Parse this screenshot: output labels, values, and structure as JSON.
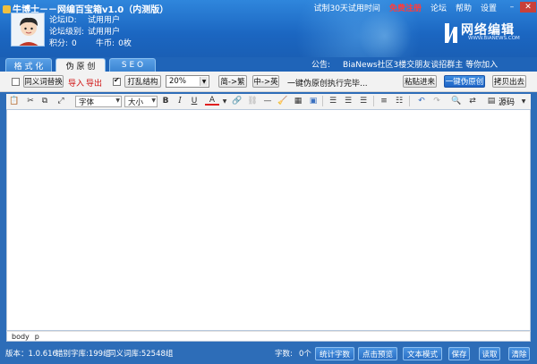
{
  "window": {
    "title": "牛博士－－网编百宝箱v1.0（内测版）",
    "topnav": {
      "trial": "试制30天试用时间",
      "register": "免费注册",
      "forum": "论坛",
      "help": "帮助",
      "settings": "设置"
    }
  },
  "user": {
    "id_label": "论坛ID:",
    "id_value": "试用用户",
    "level_label": "论坛级别:",
    "level_value": "试用用户",
    "points_label": "积分:",
    "points_value": "0",
    "coins_label": "牛币:",
    "coins_value": "0枚"
  },
  "logo": {
    "text": "网络编辑",
    "sub": "WWW.BIANEWS.COM"
  },
  "tabs": [
    {
      "label": "格 式 化"
    },
    {
      "label": "伪 原 创"
    },
    {
      "label": "S E O"
    }
  ],
  "notice": {
    "label": "公告:",
    "text": "BiaNews社区3楼交朋友谈招群主 等你加入"
  },
  "options": {
    "synonym_label": "同义词替换",
    "import_label": "导入",
    "export_label": "导出",
    "shuffle_label": "打乱结构",
    "ratio_value": "20%",
    "to_traditional": "简->繁",
    "cn_to_en": "中->英",
    "status": "一键伪原创执行完毕...",
    "paste_in": "粘贴进来",
    "one_click": "一键伪原创",
    "copy_out": "拷贝出去"
  },
  "editor": {
    "font_value": "字体",
    "size_value": "大小",
    "source_label": "源码",
    "path": [
      "body",
      "p"
    ]
  },
  "status": {
    "version": "版本：1.0.616",
    "typo_lib": "错别字库:199组",
    "synonym_lib": "同义词库:52548组",
    "char_count_label": "字数:",
    "char_count_value": "0个",
    "count_btn": "统计字数",
    "preview_btn": "点击预览",
    "text_mode_btn": "文本模式",
    "save_btn": "保存",
    "read_btn": "读取",
    "clear_btn": "清除"
  },
  "colors": {
    "header_blue": "#1b66c1",
    "bottom_blue": "#2d6db8",
    "primary_button": "#1e64c6",
    "register_red": "#ff3c3c"
  }
}
